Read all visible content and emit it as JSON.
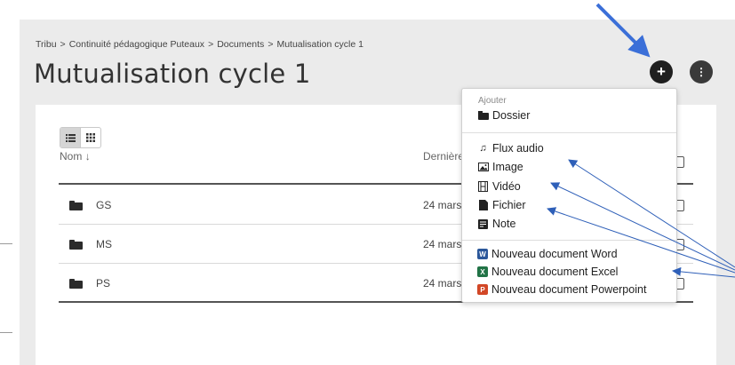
{
  "breadcrumb": {
    "items": [
      "Tribu",
      "Continuité pédagogique Puteaux",
      "Documents",
      "Mutualisation cycle 1"
    ],
    "separator": ">"
  },
  "page": {
    "title": "Mutualisation cycle 1"
  },
  "header_buttons": {
    "add_icon": "plus-icon",
    "more_icon": "more-vertical-icon"
  },
  "view_toggle": {
    "list_icon": "list-icon",
    "grid_icon": "grid-icon",
    "active": "list"
  },
  "table": {
    "columns": {
      "name": "Nom",
      "sort_arrow": "↓",
      "date": "Dernière"
    },
    "rows": [
      {
        "name": "GS",
        "date": "24 mars",
        "icon": "folder-icon"
      },
      {
        "name": "MS",
        "date": "24 mars",
        "icon": "folder-icon"
      },
      {
        "name": "PS",
        "date": "24 mars",
        "icon": "folder-icon"
      }
    ]
  },
  "add_menu": {
    "header": "Ajouter",
    "folder_item": {
      "label": "Dossier",
      "icon": "folder-icon"
    },
    "media_items": [
      {
        "label": "Flux audio",
        "icon": "music-note-icon"
      },
      {
        "label": "Image",
        "icon": "image-icon"
      },
      {
        "label": "Vidéo",
        "icon": "film-icon"
      },
      {
        "label": "Fichier",
        "icon": "file-icon"
      },
      {
        "label": "Note",
        "icon": "note-icon"
      }
    ],
    "office_items": [
      {
        "label": "Nouveau document Word",
        "badge": "W",
        "color": "#2b579a"
      },
      {
        "label": "Nouveau document Excel",
        "badge": "X",
        "color": "#217346"
      },
      {
        "label": "Nouveau document Powerpoint",
        "badge": "P",
        "color": "#d24726"
      }
    ]
  },
  "colors": {
    "annotation_arrow": "#3b6fd8",
    "annotation_line": "#2e5fb8"
  }
}
